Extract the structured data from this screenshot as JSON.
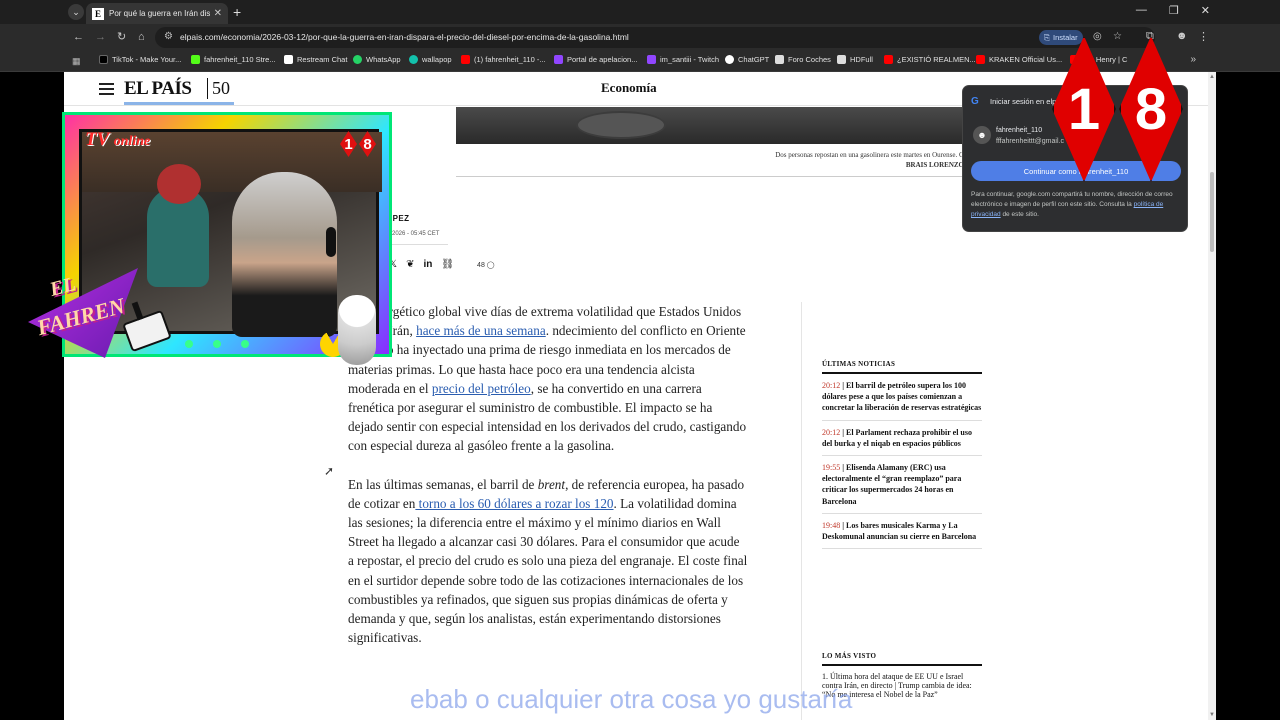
{
  "browser": {
    "tab_title": "Por qué la guerra en Irán dispa",
    "url": "elpais.com/economia/2026-03-12/por-que-la-guerra-en-iran-dispara-el-precio-del-diesel-por-encima-de-la-gasolina.html",
    "install_label": "Instalar",
    "bookmarks": [
      {
        "label": "TikTok - Make Your...",
        "color": "#000000"
      },
      {
        "label": "fahrenheit_110 Stre...",
        "color": "#53fc18"
      },
      {
        "label": "Restream Chat",
        "color": "#ffffff"
      },
      {
        "label": "WhatsApp",
        "color": "#25d366"
      },
      {
        "label": "wallapop",
        "color": "#13c1ac"
      },
      {
        "label": "(1) fahrenheit_110 -...",
        "color": "#ff0000"
      },
      {
        "label": "Portal de apelacion...",
        "color": "#9146ff"
      },
      {
        "label": "im_santiii - Twitch",
        "color": "#9146ff"
      },
      {
        "label": "ChatGPT",
        "color": "#ffffff"
      },
      {
        "label": "Foro Coches",
        "color": "#dddddd"
      },
      {
        "label": "HDFull",
        "color": "#dddddd"
      },
      {
        "label": "¿EXISTIÓ REALMEN...",
        "color": "#ff0000"
      },
      {
        "label": "KRAKEN Official Us...",
        "color": "#ff0000"
      },
      {
        "label": "ore Henry | C",
        "color": "#ff0000"
      }
    ]
  },
  "site": {
    "logo": "EL PAÍS",
    "logo_anniv": "50",
    "section": "Economía",
    "caption_line1": "Dos personas repostan en una gasolinera este martes en Ourense. G",
    "caption_credit": "BRAIS LORENZO",
    "byline": "ÓPEZ",
    "date": "R 2026 - 05:45 CET",
    "comments": "48"
  },
  "article": {
    "p1_a": "ado energético global vive días de extrema volatilidad que Estados Unidos atacó a Irán, ",
    "p1_link1": "hace más de una semana",
    "p1_b": ". ndecimiento del conflicto en Oriente Próximo ha inyectado una prima de riesgo inmediata en los mercados de materias primas. Lo que hasta hace poco era una tendencia alcista moderada en el ",
    "p1_link2": "precio del petróleo",
    "p1_c": ", se ha convertido en una carrera frenética por asegurar el suministro de combustible. El impacto se ha dejado sentir con especial intensidad en los derivados del crudo, castigando con especial dureza al gasóleo frente a la gasolina.",
    "p2_a": "En las últimas semanas, el barril de ",
    "p2_em": "brent",
    "p2_b": ", de referencia europea, ha pasado de cotizar en",
    "p2_link": " torno a los 60 dólares a rozar los 120",
    "p2_c": ". La volatilidad domina las sesiones; la diferencia entre el máximo y el mínimo diarios en Wall Street ha llegado a alcanzar casi 30 dólares. Para el consumidor que acude a repostar, el precio del crudo es solo una pieza del engranaje. El coste final en el surtidor depende sobre todo de las cotizaciones internacionales de los combustibles ya refinados, que siguen sus propias dinámicas de oferta y demanda y que, según los analistas, están experimentando distorsiones significativas."
  },
  "sidebar": {
    "latest_heading": "ÚLTIMAS NOTICIAS",
    "latest": [
      {
        "time": "20:12",
        "text": "El barril de petróleo supera los 100 dólares pese a que los países comienzan a concretar la liberación de reservas estratégicas"
      },
      {
        "time": "20:12",
        "text": "El Parlament rechaza prohibir el uso del burka y el niqab en espacios públicos"
      },
      {
        "time": "19:55",
        "text": "Elisenda Alamany (ERC) usa electoralmente el “gran reemplazo” para criticar los supermercados 24 horas en Barcelona"
      },
      {
        "time": "19:48",
        "text": "Los bares musicales Karma y La Deskomunal anuncian su cierre en Barcelona"
      }
    ],
    "most_viewed_heading": "LO MÁS VISTO",
    "most_viewed_1": "1. Última hora del ataque de EE UU e Israel contra Irán, en directo | Trump cambia de idea: “No me interesa el Nobel de la Paz”"
  },
  "google_popup": {
    "title": "Iniciar sesión en elp",
    "username": "fahrenheit_110",
    "email": "fffahrenheittt@gmail.c",
    "continue_label": "Continuar como fahrenheit_110",
    "fine_print": "Para continuar, google.com compartirá tu nombre, dirección de correo electrónico e imagen de perfil con este sitio. Consulta la ",
    "privacy_link": "política de privacidad",
    "fine_end": " de este sitio."
  },
  "overlay": {
    "tv_label_a": "TV",
    "tv_label_b": "online",
    "badge_18_a": "1",
    "badge_18_b": "8",
    "fahren_1": "EL",
    "fahren_2": "FAHREN",
    "subtitle": "ebab o cualquier otra cosa yo gustaría"
  }
}
